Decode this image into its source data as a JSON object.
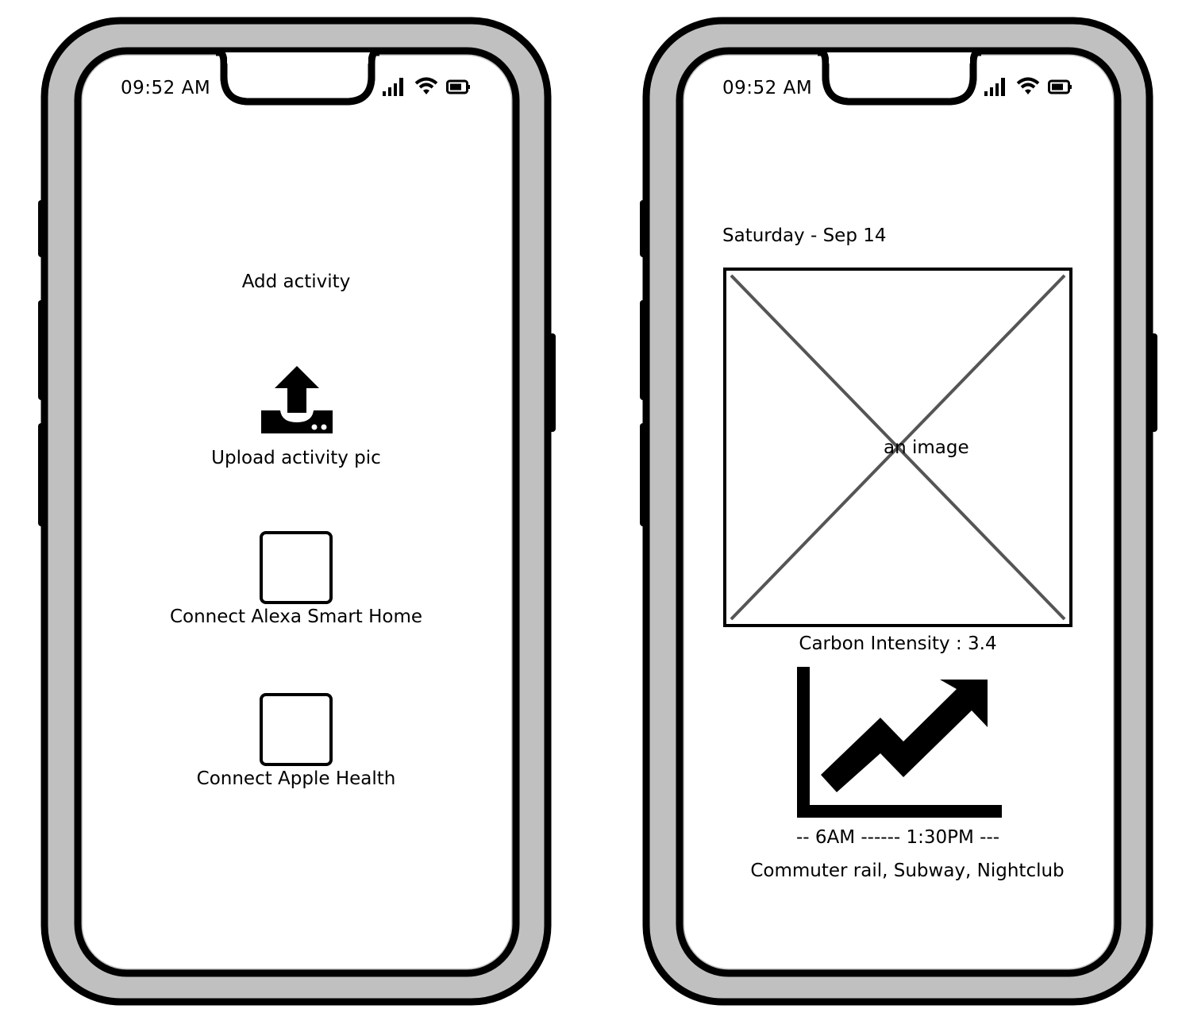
{
  "left_screen": {
    "status_time": "09:52 AM",
    "title": "Add activity",
    "upload_label": "Upload activity pic",
    "alexa_label": "Connect Alexa Smart Home",
    "apple_health_label": "Connect Apple Health"
  },
  "right_screen": {
    "status_time": "09:52 AM",
    "date": "Saturday - Sep 14",
    "image_placeholder_label": "an image",
    "carbon_intensity": "Carbon Intensity : 3.4",
    "time_range": "-- 6AM ------ 1:30PM ---",
    "activities": "Commuter rail, Subway, Nightclub"
  },
  "icons": [
    "signal-icon",
    "wifi-icon",
    "battery-icon",
    "upload-icon",
    "trend-chart-icon"
  ],
  "colors": {
    "frame": "#000000",
    "bezel": "#c0c0c0",
    "screen": "#ffffff",
    "placeholder_x": "#555555"
  }
}
